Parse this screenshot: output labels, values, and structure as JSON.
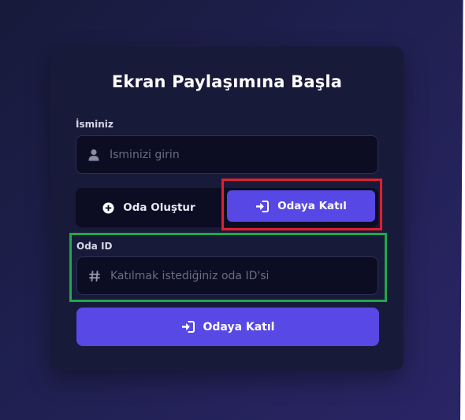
{
  "card": {
    "title": "Ekran Paylaşımına Başla"
  },
  "name_field": {
    "label": "İsminiz",
    "placeholder": "İsminizi girin",
    "value": "",
    "icon": "user-icon"
  },
  "mode_toggle": {
    "create_label": "Oda Oluştur",
    "create_icon": "plus-circle-icon",
    "join_label": "Odaya Katıl",
    "join_icon": "sign-in-icon",
    "active": "join"
  },
  "room_field": {
    "label": "Oda ID",
    "placeholder": "Katılmak istediğiniz oda ID'si",
    "value": "",
    "icon": "hash-icon"
  },
  "submit": {
    "label": "Odaya Katıl",
    "icon": "sign-in-icon"
  },
  "colors": {
    "accent": "#5747e4",
    "card_bg": "#181a39",
    "input_bg": "#0c0d22",
    "highlight_red": "#e0202f",
    "highlight_green": "#1fa84a"
  }
}
